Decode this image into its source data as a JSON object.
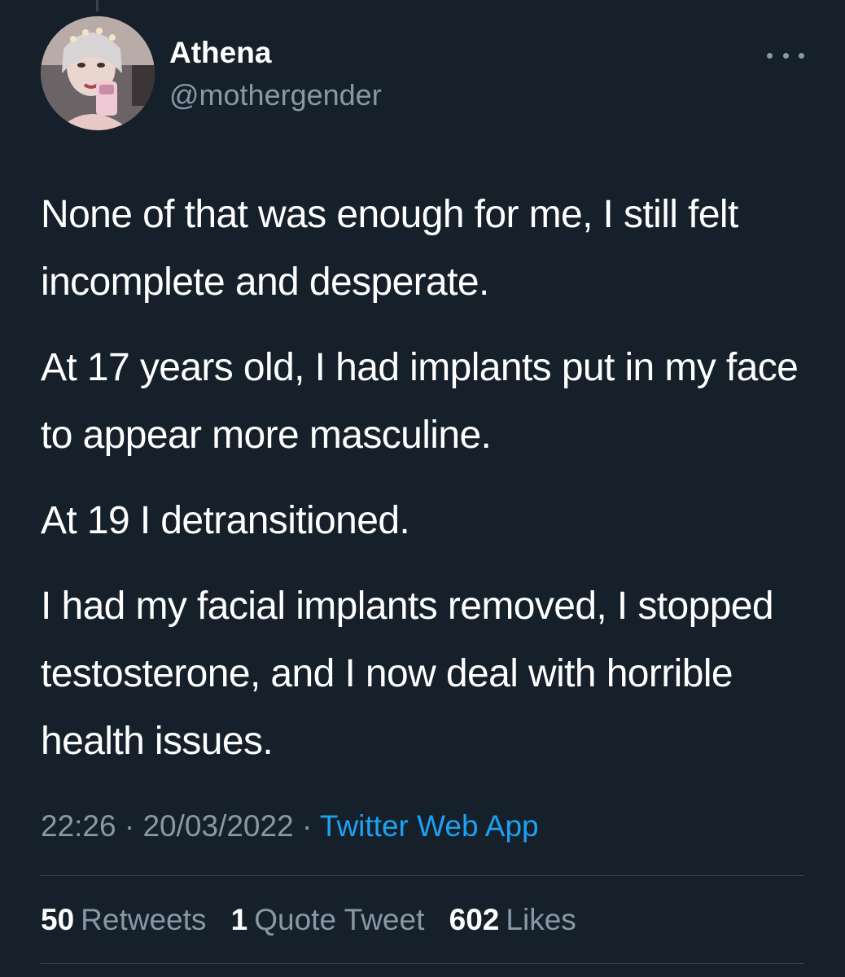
{
  "author": {
    "display_name": "Athena",
    "handle": "@mothergender"
  },
  "tweet": {
    "paragraphs": [
      "None of that was enough for me, I still felt incomplete and desperate.",
      "At 17 years old, I had implants put in my face to appear more masculine.",
      "At 19 I detransitioned.",
      "I had my facial implants removed, I stopped testosterone, and I now deal with horrible health issues."
    ],
    "time": "22:26",
    "separator": "·",
    "date": "20/03/2022",
    "source": "Twitter Web App"
  },
  "stats": {
    "retweets_count": "50",
    "retweets_label": "Retweets",
    "quotes_count": "1",
    "quotes_label": "Quote Tweet",
    "likes_count": "602",
    "likes_label": "Likes"
  },
  "icons": {
    "more": "more-horizontal-icon"
  },
  "colors": {
    "background": "#15202b",
    "primary_text": "#ffffff",
    "secondary_text": "#8899a6",
    "link": "#1da1f2",
    "divider": "#38444d"
  }
}
